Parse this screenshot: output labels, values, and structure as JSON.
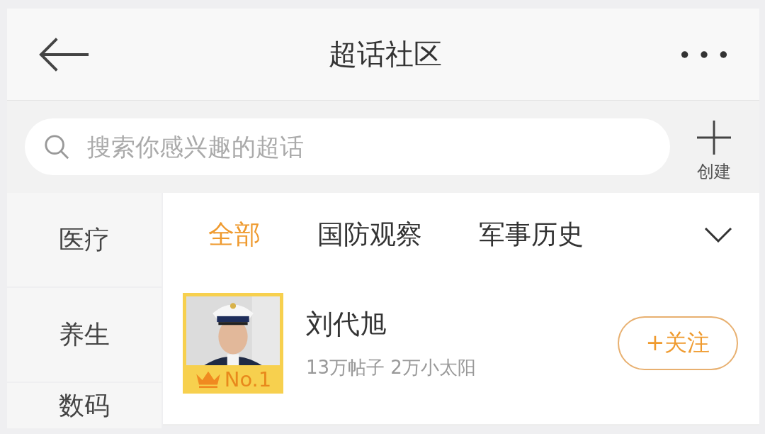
{
  "header": {
    "title": "超话社区"
  },
  "search": {
    "placeholder": "搜索你感兴趣的超话",
    "create_label": "创建"
  },
  "sidebar": {
    "items": [
      {
        "label": "医疗",
        "selected": false
      },
      {
        "label": "养生",
        "selected": false
      },
      {
        "label": "数码",
        "selected": false
      }
    ]
  },
  "tabs": [
    {
      "label": "全部",
      "selected": true
    },
    {
      "label": "国防观察",
      "selected": false
    },
    {
      "label": "军事历史",
      "selected": false
    }
  ],
  "topics": [
    {
      "name": "刘代旭",
      "badge": "No.1",
      "stats": "13万帖子 2万小太阳",
      "follow_label": "+关注"
    }
  ]
}
